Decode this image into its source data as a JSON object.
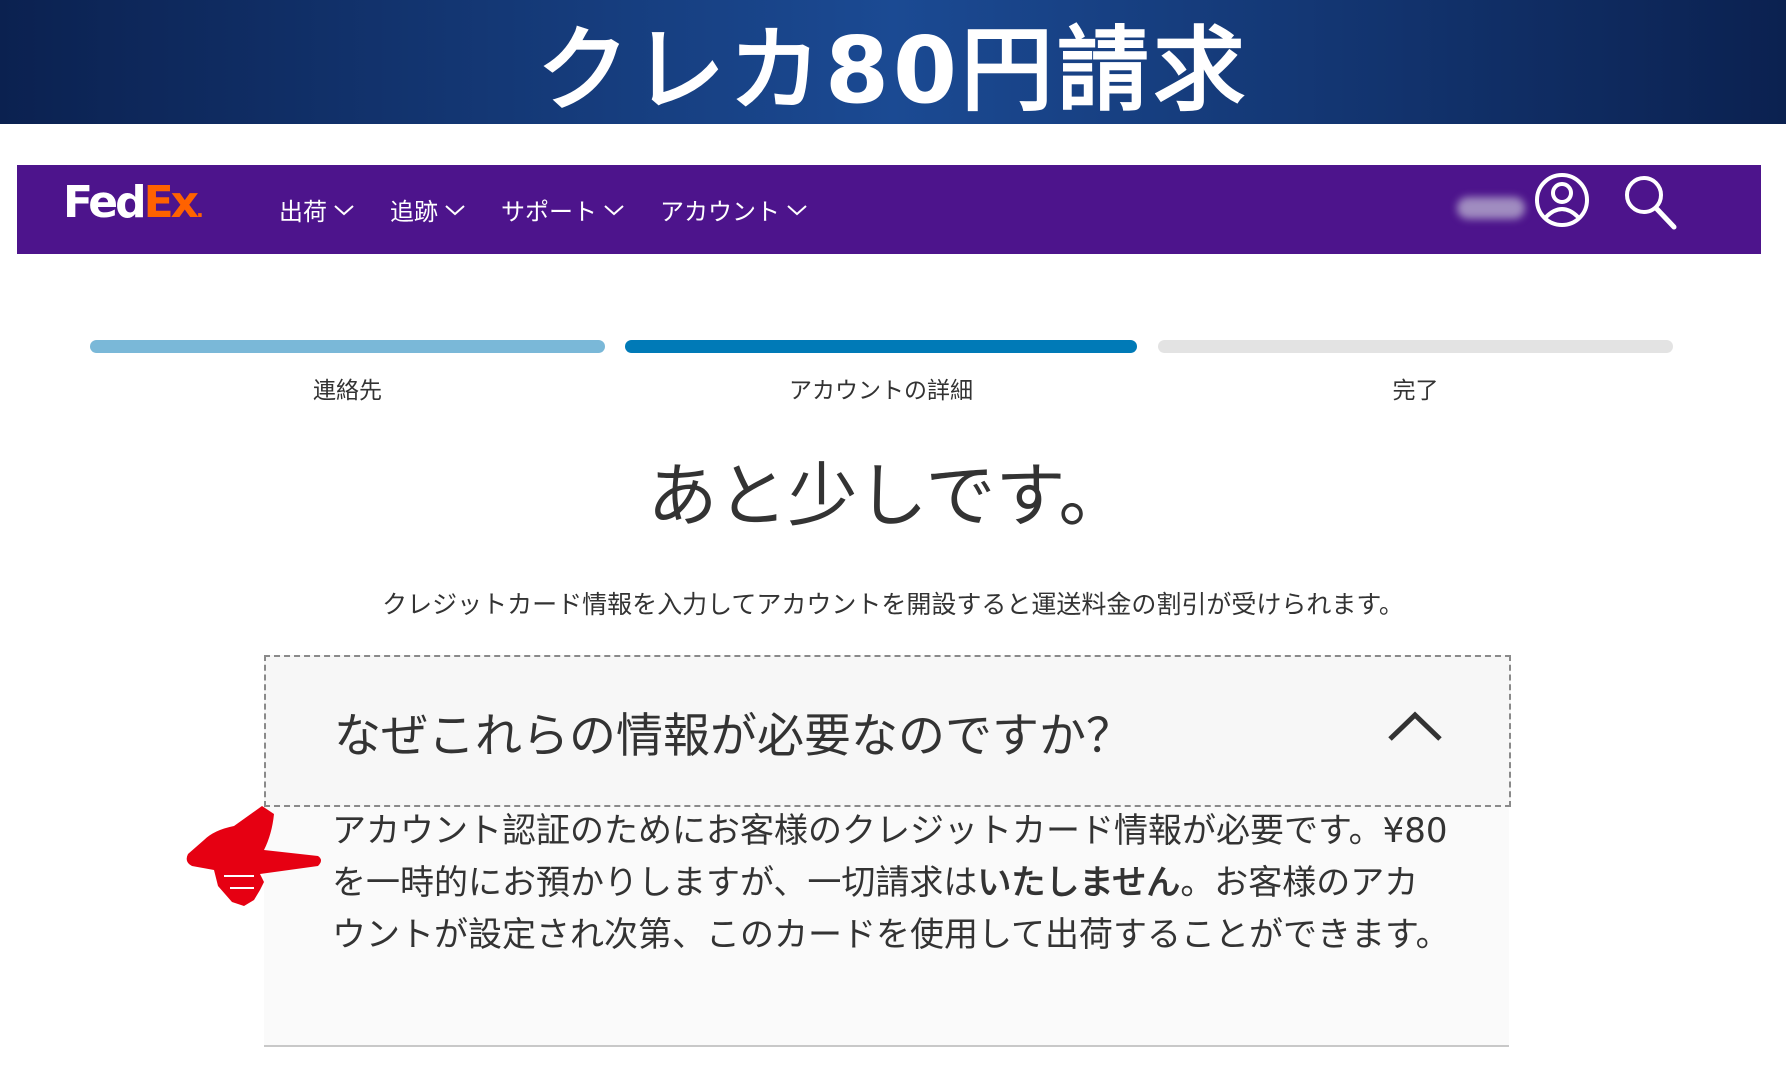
{
  "banner": {
    "title": "クレカ80円請求"
  },
  "navbar": {
    "logo_fed": "Fed",
    "logo_ex": "Ex",
    "logo_dot": ".",
    "items": [
      {
        "label": "出荷"
      },
      {
        "label": "追跡"
      },
      {
        "label": "サポート"
      },
      {
        "label": "アカウント"
      }
    ],
    "icons": [
      "chevron-down-icon",
      "user-icon",
      "search-icon"
    ],
    "brand_color": "#4d148c",
    "accent_color": "#ff6200"
  },
  "progress": {
    "steps": [
      {
        "label": "連絡先",
        "status": "completed",
        "color": "#7ab8d8"
      },
      {
        "label": "アカウントの詳細",
        "status": "current",
        "color": "#007ab7"
      },
      {
        "label": "完了",
        "status": "pending",
        "color": "#e3e3e3"
      }
    ]
  },
  "main": {
    "heading": "あと少しです。",
    "subtext": "クレジットカード情報を入力してアカウントを開設すると運送料金の割引が受けられます。"
  },
  "faq": {
    "question": "なぜこれらの情報が必要なのですか？",
    "expanded": true,
    "answer_part1": "アカウント認証のためにお客様のクレジットカード情報が必要です。¥80を一時的にお預かりしますが、一切請求は",
    "answer_bold": "いたしません",
    "answer_part2": "。お客様のアカウントが設定され次第、このカードを使用して出荷することができます。"
  },
  "annotation": {
    "icon": "pointing-hand-icon",
    "color": "#e60012"
  }
}
